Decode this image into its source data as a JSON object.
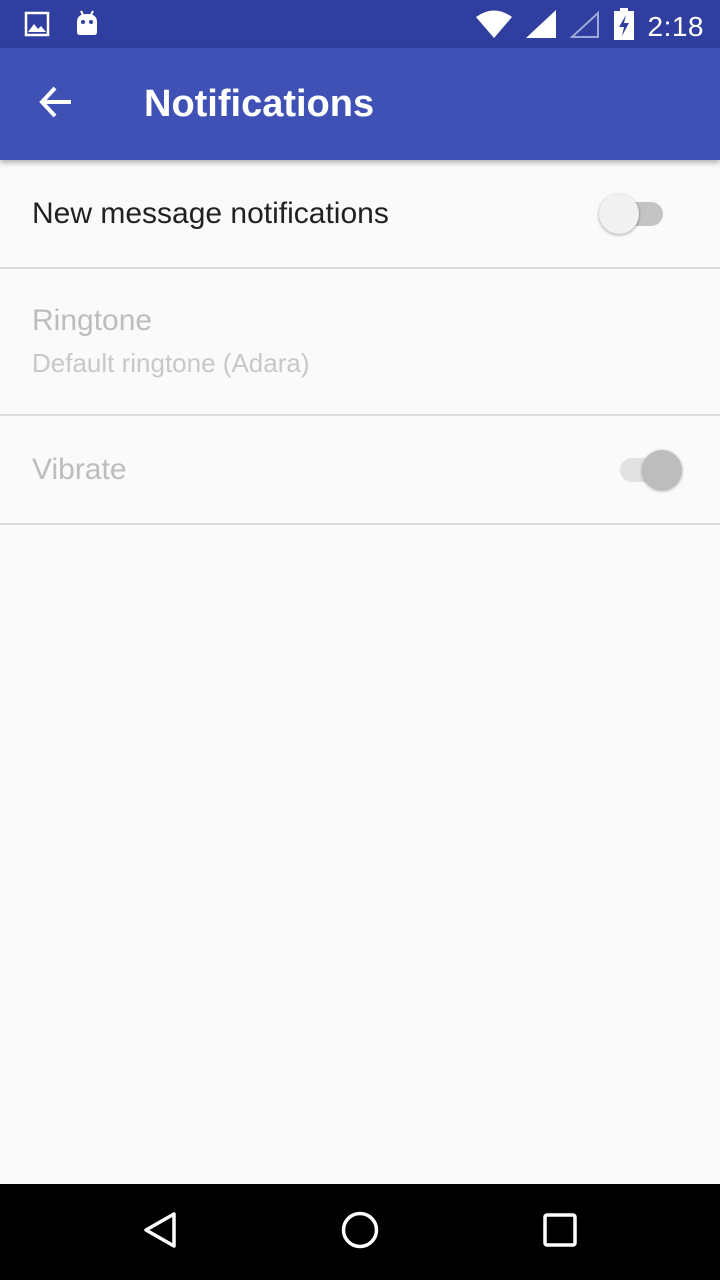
{
  "status_bar": {
    "time": "2:18",
    "left_icons": [
      "image-icon",
      "android-icon"
    ],
    "right_icons": [
      "wifi-icon",
      "signal-icon",
      "signal-empty-icon",
      "battery-charging-icon"
    ],
    "color": "#303f9f"
  },
  "app_bar": {
    "title": "Notifications",
    "back_icon": "arrow-back-icon",
    "color": "#3f51b5"
  },
  "preferences": [
    {
      "title": "New message notifications",
      "enabled": true,
      "widget": "switch",
      "checked": false
    },
    {
      "title": "Ringtone",
      "summary": "Default ringtone (Adara)",
      "enabled": false
    },
    {
      "title": "Vibrate",
      "enabled": false,
      "widget": "switch",
      "checked": true
    }
  ],
  "nav_bar": {
    "buttons": [
      "back-triangle-icon",
      "home-circle-icon",
      "recents-square-icon"
    ]
  }
}
